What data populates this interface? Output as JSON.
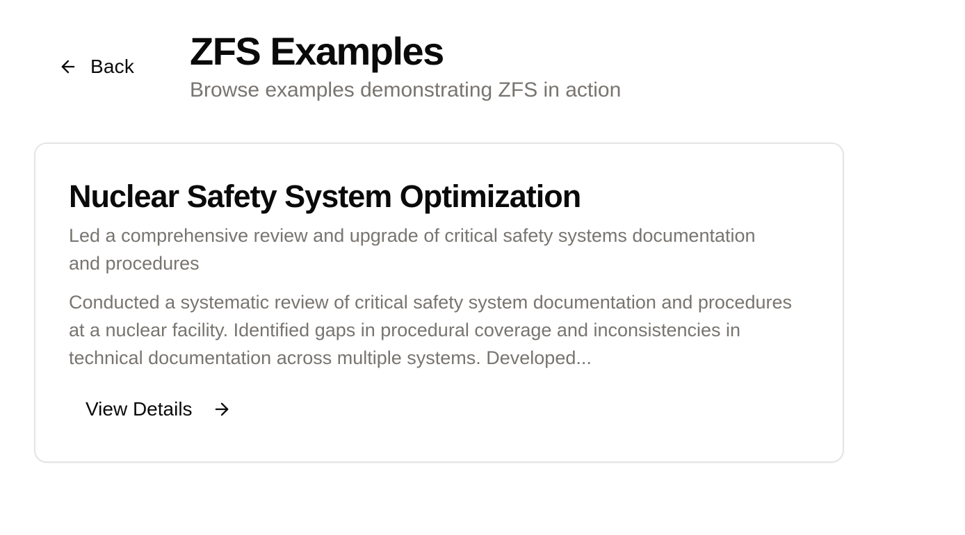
{
  "nav": {
    "back_label": "Back",
    "back_icon": "arrow-left-icon"
  },
  "header": {
    "title": "ZFS Examples",
    "subtitle": "Browse examples demonstrating ZFS in action"
  },
  "examples": [
    {
      "title": "Nuclear Safety System Optimization",
      "description": "Led a comprehensive review and upgrade of critical safety systems documentation and procedures",
      "content": "Conducted a systematic review of critical safety system documentation and procedures at a nuclear facility. Identified gaps in procedural coverage and inconsistencies in technical documentation across multiple systems. Developed...",
      "action_label": "View Details",
      "action_icon": "arrow-right-icon"
    }
  ],
  "colors": {
    "text_primary": "#0a0a0a",
    "text_muted": "#787470",
    "card_border": "#e6e4e2",
    "background": "#ffffff"
  }
}
